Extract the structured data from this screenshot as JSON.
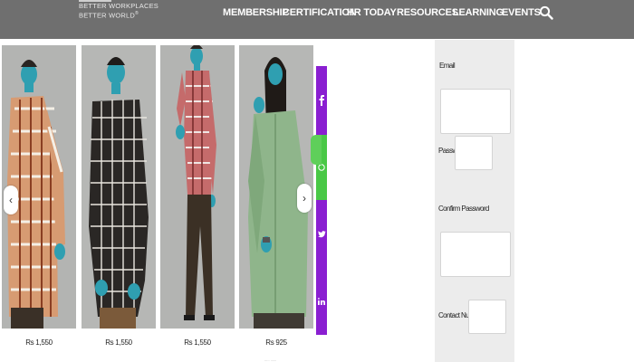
{
  "header": {
    "logo_line1": "BETTER WORKPLACES",
    "logo_line2": "BETTER WORLD",
    "logo_mark": "®",
    "nav": [
      {
        "label": "MEMBERSHIP"
      },
      {
        "label": "CERTIFICATION"
      },
      {
        "label": "HR TODAY"
      },
      {
        "label": "RESOURCES"
      },
      {
        "label": "LEARNING"
      },
      {
        "label": "EVENTS"
      }
    ],
    "search_icon": "search-icon"
  },
  "carousel": {
    "prev_icon": "chevron-left-icon",
    "next_icon": "chevron-right-icon",
    "prev_glyph": "‹",
    "next_glyph": "›",
    "products": [
      {
        "price": "Rs 1,550",
        "image": "model-checked-brown-shirt"
      },
      {
        "price": "Rs 1,550",
        "image": "model-black-check-shirt"
      },
      {
        "price": "Rs 1,550",
        "image": "model-red-check-shirt"
      },
      {
        "price": "Rs 925",
        "image": "model-green-shirt"
      }
    ],
    "pager_text": "..... ......"
  },
  "social": {
    "items": [
      {
        "icon": "facebook-icon",
        "color": "#8a1fd1"
      },
      {
        "icon": "whatsapp-icon",
        "color": "#49c846"
      },
      {
        "icon": "twitter-icon",
        "color": "#8a1fd1"
      },
      {
        "icon": "linkedin-icon",
        "color": "#8a1fd1"
      }
    ]
  },
  "form": {
    "email_label": "Email",
    "password_label": "Password",
    "confirm_label": "Confirm Password",
    "contact_label": "Contact Number",
    "email_value": "",
    "password_value": "",
    "confirm_value": "",
    "contact_value": ""
  },
  "colors": {
    "topbar": "#6f6f6f",
    "form_panel": "#ececec",
    "social_purple": "#8a1fd1",
    "social_green": "#49c846"
  }
}
